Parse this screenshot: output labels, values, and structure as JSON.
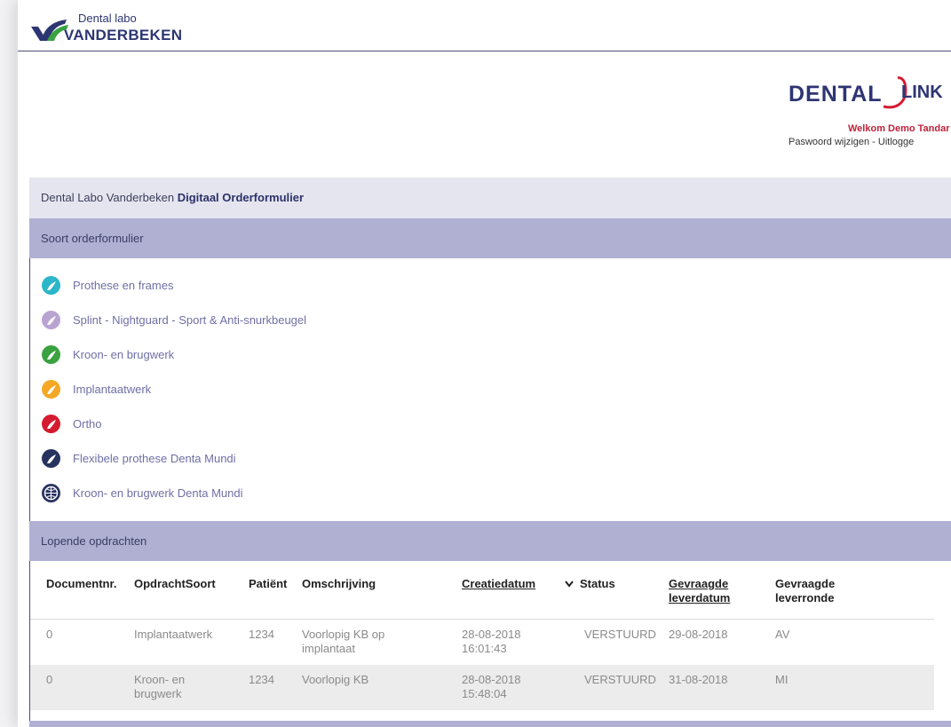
{
  "header": {
    "logo_top": "Dental labo",
    "logo_bottom": "VANDERBEKEN",
    "brand_left": "DENTAL",
    "brand_right": "LINK",
    "welcome": "Welkom Demo Tandar",
    "change_password": "Paswoord wijzigen",
    "separator": " - ",
    "logout": "Uitlogge"
  },
  "titlebar": {
    "prefix": "Dental Labo Vanderbeken ",
    "bold": "Digitaal Orderformulier"
  },
  "order_types_section": {
    "title": "Soort orderformulier",
    "items": [
      {
        "label": "Prothese en frames",
        "color": "#2bb6c9",
        "icon": "tooth-swoosh-icon"
      },
      {
        "label": "Splint - Nightguard - Sport & Anti-snurkbeugel",
        "color": "#b9a3d1",
        "icon": "tooth-swoosh-icon"
      },
      {
        "label": "Kroon- en brugwerk",
        "color": "#3aa240",
        "icon": "tooth-swoosh-icon"
      },
      {
        "label": "Implantaatwerk",
        "color": "#f5a825",
        "icon": "tooth-swoosh-icon"
      },
      {
        "label": "Ortho",
        "color": "#d51b30",
        "icon": "tooth-swoosh-icon"
      },
      {
        "label": "Flexibele prothese Denta Mundi",
        "color": "#27335f",
        "icon": "tooth-swoosh-icon"
      },
      {
        "label": "Kroon- en brugwerk Denta Mundi",
        "color": "#27335f",
        "icon": "globe-tooth-icon"
      }
    ]
  },
  "running_section": {
    "title": "Lopende opdrachten",
    "columns": {
      "docnr": "Documentnr.",
      "type": "OpdrachtSoort",
      "patient": "Patiënt",
      "desc": "Omschrijving",
      "created": "Creatiedatum",
      "sort_icon": "chevron-down-icon",
      "status": "Status",
      "req_date": "Gevraagde leverdatum",
      "req_round": "Gevraagde leverronde"
    },
    "rows": [
      {
        "docnr": "0",
        "type": "Implantaatwerk",
        "patient": "1234",
        "desc": "Voorlopig KB op implantaat",
        "created": "28-08-2018 16:01:43",
        "status": "VERSTUURD",
        "req_date": "29-08-2018",
        "req_round": "AV"
      },
      {
        "docnr": "0",
        "type": "Kroon- en brugwerk",
        "patient": "1234",
        "desc": "Voorlopig KB",
        "created": "28-08-2018 15:48:04",
        "status": "VERSTUURD",
        "req_date": "31-08-2018",
        "req_round": "MI"
      }
    ]
  },
  "colors": {
    "navy": "#2d3572",
    "accent_red": "#c0213a",
    "section_bar": "#afb0d2",
    "title_bar": "#e4e5ef"
  }
}
